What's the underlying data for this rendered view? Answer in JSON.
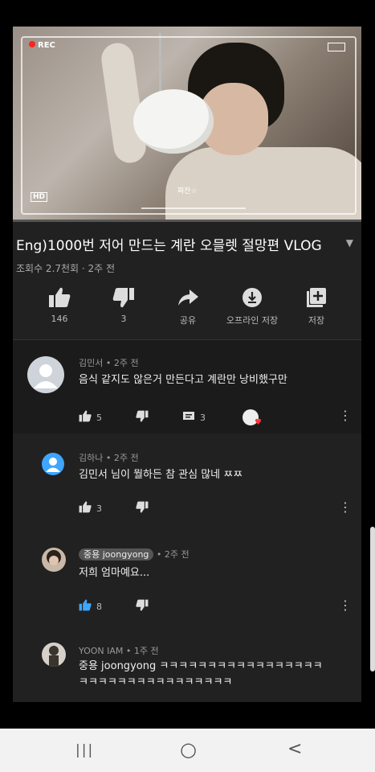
{
  "video": {
    "rec_label": "REC",
    "hd_label": "HD",
    "caption_tag": "짜잔☆",
    "progress_fraction": 0.0
  },
  "title": "Eng)1000번 저어 만드는 계란 오믈렛 절망편 VLOG",
  "meta": "조회수 2.7천회 · 2주 전",
  "actions": [
    {
      "icon": "thumbs-up-icon",
      "label": "146"
    },
    {
      "icon": "thumbs-down-icon",
      "label": "3"
    },
    {
      "icon": "share-icon",
      "label": "공유"
    },
    {
      "icon": "download-icon",
      "label": "오프라인 저장"
    },
    {
      "icon": "add-to-playlist-icon",
      "label": "저장"
    }
  ],
  "comments": [
    {
      "author": "김민서 • 2주 전",
      "text": "음식 같지도 않은거 만든다고 계란만 낭비했구만",
      "likes": "5",
      "replies": "3"
    },
    {
      "author": "김하나 • 2주 전",
      "text": "김민서 님이 뭘하든 참 관심 많네 ㅉㅉ",
      "likes": "3"
    },
    {
      "author_chip": "중용 joongyong",
      "author_time": "• 2주 전",
      "text": "저희 엄마예요...",
      "likes": "8"
    },
    {
      "author": "YOON IAM • 1주 전",
      "text_line1": "중용 joongyong ㅋㅋㅋㅋㅋㅋㅋㅋㅋㅋㅋㅋㅋㅋㅋㅋㅋ",
      "text_line2": "ㅋㅋㅋㅋㅋㅋㅋㅋㅋㅋㅋㅋㅋㅋㅋㅋ"
    }
  ],
  "navbar": {
    "recent": "|||",
    "home": "○",
    "back": "<"
  },
  "colors": {
    "background": "#212121",
    "accent_like": "#3ea6ff",
    "progress": "#e62117"
  }
}
